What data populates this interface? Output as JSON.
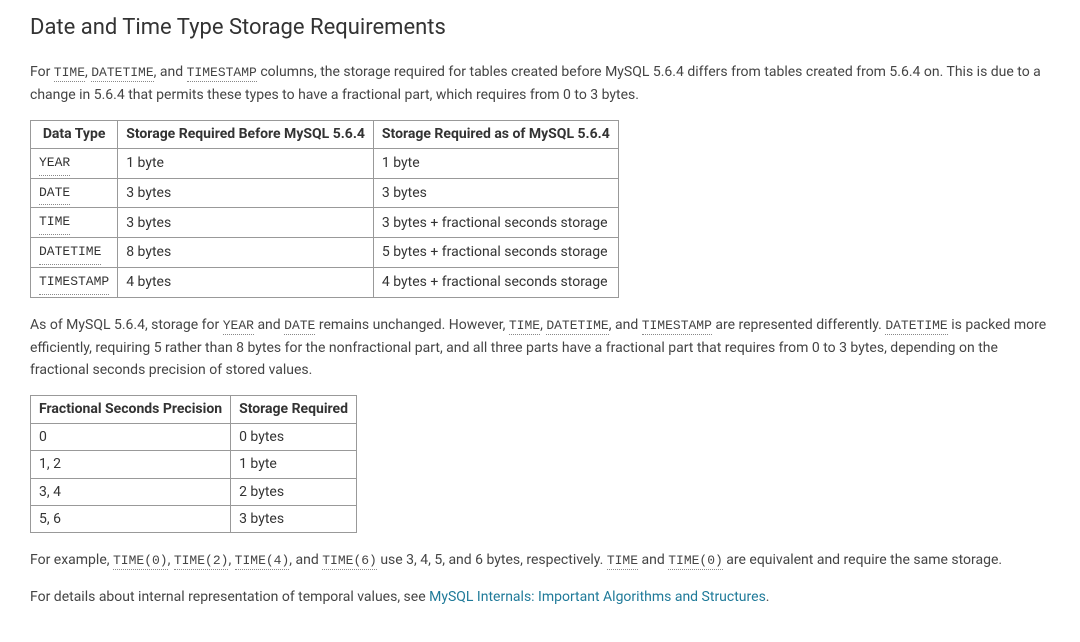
{
  "heading": "Date and Time Type Storage Requirements",
  "para1": {
    "pre": "For ",
    "w1": "TIME",
    "sep1": ", ",
    "w2": "DATETIME",
    "sep2": ", and ",
    "w3": "TIMESTAMP",
    "post": " columns, the storage required for tables created before MySQL 5.6.4 differs from tables created from 5.6.4 on. This is due to a change in 5.6.4 that permits these types to have a fractional part, which requires from 0 to 3 bytes."
  },
  "table1": {
    "headers": [
      "Data Type",
      "Storage Required Before MySQL 5.6.4",
      "Storage Required as of MySQL 5.6.4"
    ],
    "rows": [
      {
        "t": "YEAR",
        "b": "1 byte",
        "a": "1 byte"
      },
      {
        "t": "DATE",
        "b": "3 bytes",
        "a": "3 bytes"
      },
      {
        "t": "TIME",
        "b": "3 bytes",
        "a": "3 bytes + fractional seconds storage"
      },
      {
        "t": "DATETIME",
        "b": "8 bytes",
        "a": "5 bytes + fractional seconds storage"
      },
      {
        "t": "TIMESTAMP",
        "b": "4 bytes",
        "a": "4 bytes + fractional seconds storage"
      }
    ]
  },
  "para2": {
    "pre": "As of MySQL 5.6.4, storage for ",
    "w1": "YEAR",
    "sep1": " and ",
    "w2": "DATE",
    "mid1": " remains unchanged. However, ",
    "w3": "TIME",
    "sep2": ", ",
    "w4": "DATETIME",
    "sep3": ", and ",
    "w5": "TIMESTAMP",
    "mid2": " are represented differently. ",
    "w6": "DATETIME",
    "post": " is packed more efficiently, requiring 5 rather than 8 bytes for the nonfractional part, and all three parts have a fractional part that requires from 0 to 3 bytes, depending on the fractional seconds precision of stored values."
  },
  "table2": {
    "headers": [
      "Fractional Seconds Precision",
      "Storage Required"
    ],
    "rows": [
      {
        "p": "0",
        "s": "0 bytes"
      },
      {
        "p": "1, 2",
        "s": "1 byte"
      },
      {
        "p": "3, 4",
        "s": "2 bytes"
      },
      {
        "p": "5, 6",
        "s": "3 bytes"
      }
    ]
  },
  "para3": {
    "pre": "For example, ",
    "w1": "TIME(0)",
    "sep1": ", ",
    "w2": "TIME(2)",
    "sep2": ", ",
    "w3": "TIME(4)",
    "sep3": ", and ",
    "w4": "TIME(6)",
    "mid": " use 3, 4, 5, and 6 bytes, respectively. ",
    "w5": "TIME",
    "sep4": " and ",
    "w6": "TIME(0)",
    "post": " are equivalent and require the same storage."
  },
  "para4": {
    "pre": "For details about internal representation of temporal values, see ",
    "link": "MySQL Internals: Important Algorithms and Structures",
    "post": "."
  }
}
